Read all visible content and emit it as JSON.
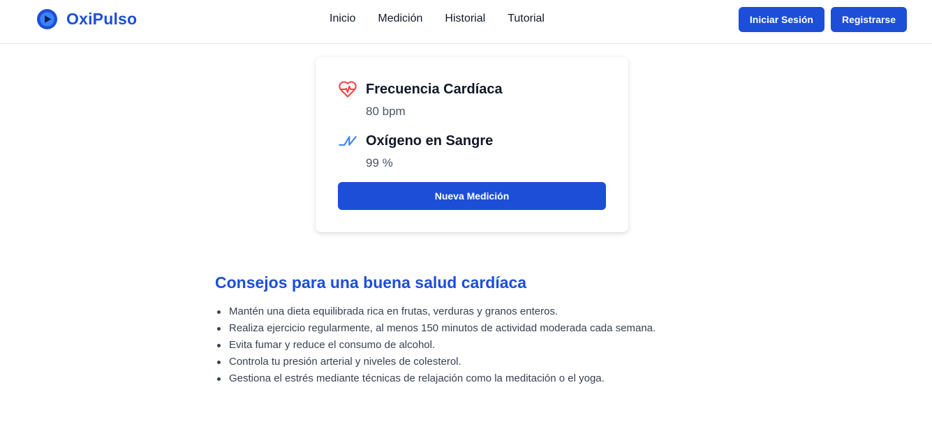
{
  "brand": {
    "name": "OxiPulso",
    "logo_icon": "play-circle-icon"
  },
  "nav": {
    "items": [
      {
        "label": "Inicio"
      },
      {
        "label": "Medición"
      },
      {
        "label": "Historial"
      },
      {
        "label": "Tutorial"
      }
    ]
  },
  "auth": {
    "login_label": "Iniciar Sesión",
    "register_label": "Registrarse"
  },
  "card": {
    "heart_rate": {
      "icon": "heart-pulse-icon",
      "title": "Frecuencia Cardíaca",
      "value": "80 bpm"
    },
    "oxygen": {
      "icon": "activity-icon",
      "title": "Oxígeno en Sangre",
      "value": "99 %"
    },
    "new_measure_label": "Nueva Medición"
  },
  "tips": {
    "title": "Consejos para una buena salud cardíaca",
    "items": [
      "Mantén una dieta equilibrada rica en frutas, verduras y granos enteros.",
      "Realiza ejercicio regularmente, al menos 150 minutos de actividad moderada cada semana.",
      "Evita fumar y reduce el consumo de alcohol.",
      "Controla tu presión arterial y niveles de colesterol.",
      "Gestiona el estrés mediante técnicas de relajación como la meditación o el yoga."
    ]
  },
  "colors": {
    "primary": "#1d4ed8",
    "heart": "#ef4444",
    "oxygen": "#3b82f6"
  }
}
